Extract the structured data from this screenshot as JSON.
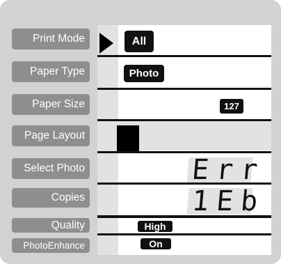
{
  "menu": {
    "print_mode": "Print Mode",
    "paper_type": "Paper Type",
    "paper_size": "Paper Size",
    "page_layout": "Page Layout",
    "select_photo": "Select Photo",
    "copies": "Copies",
    "quality": "Quality",
    "photo_enhance": "PhotoEnhance"
  },
  "display": {
    "print_mode_value": "All",
    "paper_type_value": "Photo",
    "paper_size_value": "127",
    "select_photo_value": "Err",
    "copies_value": "1Eb",
    "quality_value": "High",
    "photo_enhance_value": "On"
  },
  "icons": {
    "row_pointer": "triangle-pointer-icon",
    "layout_cursor": "layout-block-icon"
  },
  "colors": {
    "panel_bg": "#d2d2d2",
    "button_bg": "#8e8e8e",
    "lcd_bg": "#ffffff",
    "lcd_band": "#e2e2e2",
    "ink": "#111111"
  }
}
